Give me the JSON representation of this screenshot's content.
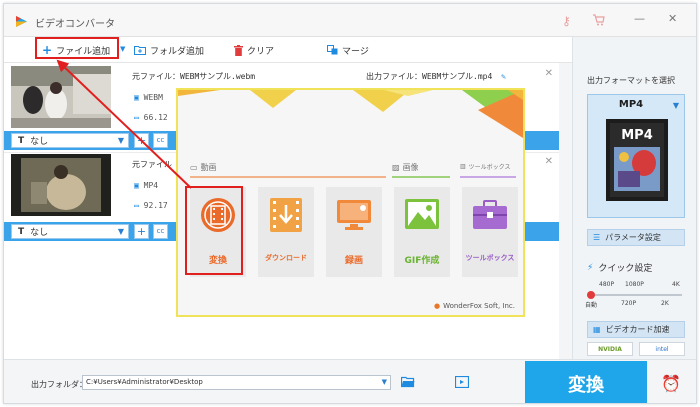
{
  "app": {
    "title": "ビデオコンバータ"
  },
  "titlebar": {
    "key_icon": "key-icon",
    "cart_icon": "cart-icon",
    "minimize": "—",
    "close": "✕"
  },
  "toolbar": {
    "add_file": "ファイル追加",
    "add_folder": "フォルダ追加",
    "clear": "クリア",
    "merge": "マージ"
  },
  "files": [
    {
      "source": "元ファイル：WEBMサンプル.webm",
      "format": "WEBM",
      "size": "66.12",
      "output": "出力ファイル：WEBMサンプル.mp4",
      "subtitle": "なし"
    },
    {
      "source": "元ファイル",
      "format": "MP4",
      "size": "92.17",
      "subtitle": "なし"
    }
  ],
  "overlay": {
    "section_video": "動画",
    "section_image": "画像",
    "section_toolbox": "ツールボックス",
    "tiles": [
      {
        "label": "変換",
        "color": "#ea6a2a"
      },
      {
        "label": "ダウンロード",
        "color": "#ea6a2a"
      },
      {
        "label": "録画",
        "color": "#ea6a2a"
      },
      {
        "label": "GIF作成",
        "color": "#6ab330"
      },
      {
        "label": "ツールボックス",
        "color": "#9a5cc7"
      }
    ],
    "brand": "WonderFox Soft, Inc."
  },
  "right_panel": {
    "title": "出力フォーマットを選択",
    "format": "MP4",
    "format_icon_text": "MP4",
    "param_button": "パラメータ設定",
    "quick_setting": "クイック設定",
    "top_labels": [
      "480P",
      "1080P",
      "4K"
    ],
    "bottom_labels": [
      "自動",
      "720P",
      "2K"
    ],
    "gpu_button": "ビデオカード加速",
    "gpu_nvidia": "NVIDIA",
    "gpu_intel": "intel"
  },
  "bottom": {
    "out_label": "出力フォルダ：",
    "out_path": "C:¥Users¥Administrator¥Desktop",
    "convert": "変換"
  },
  "colors": {
    "accent_blue": "#1fa5ea",
    "highlight_red": "#e21f1f",
    "overlay_border": "#f0e35a"
  }
}
